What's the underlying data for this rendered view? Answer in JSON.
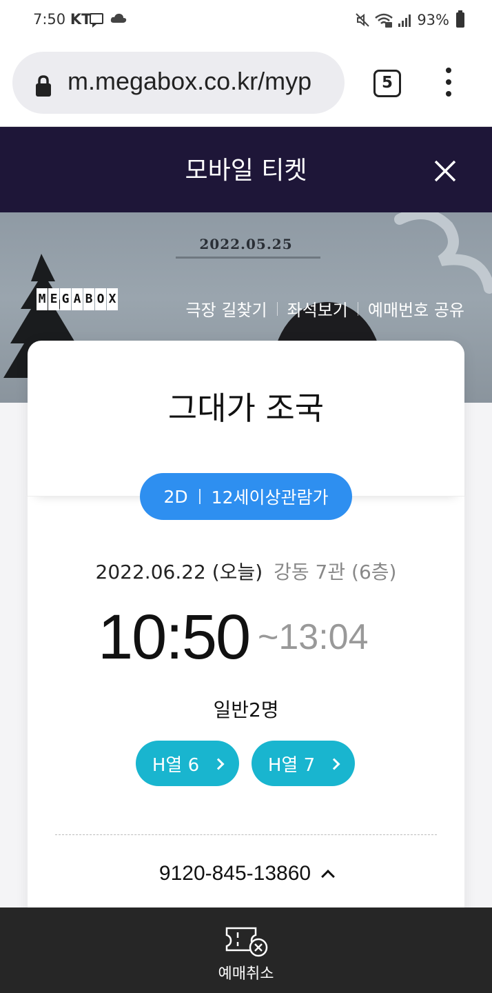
{
  "status_bar": {
    "time": "7:50",
    "carrier": "KT",
    "battery": "93%"
  },
  "browser": {
    "url": "m.megabox.co.kr/myp",
    "tab_count": "5"
  },
  "header": {
    "title": "모바일 티켓"
  },
  "poster": {
    "date": "2022.05.25",
    "logo_letters": [
      "M",
      "E",
      "G",
      "A",
      "B",
      "O",
      "X"
    ],
    "links": [
      "극장 길찾기",
      "좌석보기",
      "예매번호 공유"
    ]
  },
  "ticket": {
    "movie_title": "그대가 조국",
    "format": "2D",
    "rating": "12세이상관람가",
    "date": "2022.06.22 (오늘)",
    "cinema": "강동 7관 (6층)",
    "start_time": "10:50",
    "end_time": "~13:04",
    "audience": "일반2명",
    "seats": [
      "H열 6",
      "H열 7"
    ],
    "booking_number": "9120-845-13860"
  },
  "bottom_bar": {
    "cancel_label": "예매취소"
  },
  "colors": {
    "header_bg": "#1e1638",
    "format_pill": "#2e8ff0",
    "seat_pill": "#19b5cf",
    "bottom_bar": "#262626"
  }
}
